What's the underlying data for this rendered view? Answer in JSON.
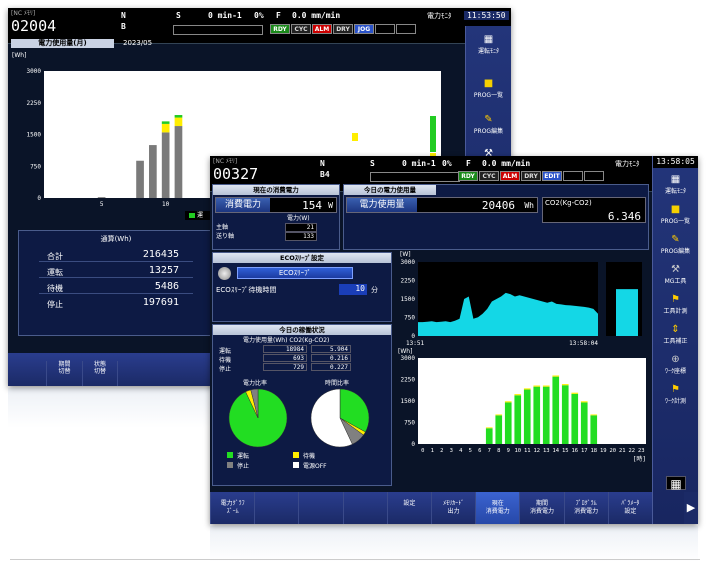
{
  "back": {
    "mode_small": "[NC ﾒﾓﾘ]",
    "prog": "02004",
    "axis1": "N",
    "axis2": "B",
    "spindle_label": "S",
    "spindle_val": "0 min-1",
    "pct": "0%",
    "feed_label": "F",
    "feed_val": "0.0 mm/min",
    "monitor": "電力ﾓﾆﾀ",
    "time": "11:53:50",
    "status": [
      "RDY",
      "CYC",
      "ALM",
      "DRY",
      "JOG"
    ],
    "chart_title": "電力使用量(月)",
    "chart_date": "2023/05",
    "yunit": "[Wh]",
    "legend_partial": "運",
    "table_title": "通算(Wh)",
    "table": [
      {
        "label": "合計",
        "value": "216435"
      },
      {
        "label": "運転",
        "value": "13257"
      },
      {
        "label": "待機",
        "value": "5486"
      },
      {
        "label": "停止",
        "value": "197691"
      }
    ],
    "keys": [
      [
        "期間",
        "切替"
      ],
      [
        "状態",
        "切替"
      ]
    ],
    "side": [
      "運転ﾓﾆﾀ",
      "PROG一覧",
      "PROG編集"
    ]
  },
  "front": {
    "mode_small": "[NC ﾒﾓﾘ]",
    "prog": "00327",
    "axis1": "N",
    "axis2": "B4",
    "spindle_label": "S",
    "spindle_val": "0 min-1",
    "pct": "0%",
    "feed_label": "F",
    "feed_val": "0.0 mm/min",
    "monitor": "電力ﾓﾆﾀ",
    "time": "13:58:05",
    "status": [
      "RDY",
      "CYC",
      "ALM",
      "DRY",
      "EDIT"
    ],
    "cur_title": "現在の消費電力",
    "cur_label": "消費電力",
    "cur_val": "154",
    "cur_unit": "W",
    "today_title": "今日の電力使用量",
    "today_label": "電力使用量",
    "today_val": "20406",
    "today_unit": "Wh",
    "co2_label": "CO2(Kg-CO2)",
    "co2_val": "6.346",
    "pw_head": "電力(W)",
    "pw_rows": [
      {
        "label": "主軸",
        "value": "21"
      },
      {
        "label": "送り軸",
        "value": "133"
      }
    ],
    "eco_title": "ECOｽﾘｰﾌﾟ設定",
    "eco_btn": "ECOｽﾘｰﾌﾟ",
    "eco_wait_label": "ECOｽﾘｰﾌﾟ待機時間",
    "eco_wait_val": "10",
    "eco_wait_unit": "分",
    "stat_title": "今日の稼働状況",
    "stat_head": "電力使用量(Wh) CO2(Kg-CO2)",
    "stat_rows": [
      {
        "label": "運転",
        "wh": "18984",
        "co2": "5.904"
      },
      {
        "label": "待機",
        "wh": "693",
        "co2": "0.216"
      },
      {
        "label": "停止",
        "wh": "729",
        "co2": "0.227"
      }
    ],
    "pie1_title": "電力比率",
    "pie2_title": "時間比率",
    "legend": [
      "運転",
      "待機",
      "停止",
      "電源OFF"
    ],
    "w_unit": "[W]",
    "wh_unit": "[Wh]",
    "w_ticks": [
      "3000",
      "2250",
      "1500",
      "750",
      "0"
    ],
    "wh_ticks": [
      "3000",
      "2250",
      "1500",
      "750",
      "0"
    ],
    "t_start": "13:51",
    "t_end": "13:58:04",
    "hour_unit": "[時]",
    "keys": [
      [
        "電力ｸﾞﾗﾌ",
        "ｽﾞｰﾑ"
      ],
      [
        ""
      ],
      [
        ""
      ],
      [
        ""
      ],
      [
        "設定"
      ],
      [
        "ﾒﾓﾘｶｰﾄﾞ",
        "出力"
      ],
      [
        "現在",
        "消費電力"
      ],
      [
        "期間",
        "消費電力"
      ],
      [
        "ﾌﾟﾛｸﾞﾗﾑ",
        "消費電力"
      ],
      [
        "ﾊﾟﾗﾒｰﾀ",
        "設定"
      ]
    ],
    "side": [
      "運転ﾓﾆﾀ",
      "PROG一覧",
      "PROG編集",
      "MG工具",
      "工具計測",
      "工具補正",
      "ﾜｰｸ座標",
      "ﾜｰｸ計測"
    ]
  },
  "chart_data": [
    {
      "type": "bar",
      "title": "電力使用量(月)",
      "ylabel": "[Wh]",
      "ylim": [
        0,
        3000
      ],
      "yticks": [
        0,
        750,
        1500,
        2250,
        3000
      ],
      "xticks": [
        5,
        10
      ],
      "categories": [
        1,
        2,
        3,
        4,
        5,
        6,
        7,
        8,
        9,
        10,
        11,
        12,
        13,
        14,
        15,
        16,
        17,
        18,
        19,
        20,
        21,
        22,
        23,
        24,
        25,
        26,
        27,
        28,
        29,
        30,
        31
      ],
      "series": [
        {
          "color": "#7a7a7a",
          "values": [
            0,
            0,
            0,
            0,
            20,
            0,
            0,
            880,
            1250,
            1550,
            1700,
            0,
            0,
            0,
            0,
            0,
            0,
            0,
            0,
            0,
            0,
            0,
            0,
            0,
            0,
            0,
            0,
            0,
            0,
            0,
            0
          ]
        },
        {
          "color": "#ffee00",
          "values": [
            0,
            0,
            0,
            0,
            0,
            0,
            0,
            0,
            0,
            200,
            200,
            0,
            0,
            0,
            0,
            0,
            0,
            0,
            0,
            0,
            0,
            0,
            0,
            0,
            0,
            0,
            0,
            0,
            0,
            0,
            0
          ]
        },
        {
          "color": "#22cc22",
          "values": [
            0,
            0,
            0,
            0,
            0,
            0,
            0,
            0,
            0,
            60,
            60,
            0,
            0,
            0,
            0,
            0,
            0,
            0,
            0,
            0,
            0,
            0,
            0,
            0,
            0,
            0,
            0,
            0,
            0,
            0,
            0
          ]
        }
      ]
    },
    {
      "type": "area",
      "title": "",
      "ylabel": "[W]",
      "ylim": [
        0,
        3000
      ],
      "x_range": [
        "13:51",
        "13:58:04"
      ],
      "yticks": [
        0,
        750,
        1500,
        2250,
        3000
      ],
      "values": [
        560,
        560,
        580,
        600,
        560,
        580,
        600,
        560,
        620,
        700,
        1500,
        1600,
        700,
        760,
        900,
        1100,
        1400,
        1500,
        1600,
        1750,
        1700,
        1600,
        1650,
        1600,
        1550,
        1500,
        1450,
        1400,
        1350,
        1400,
        1300,
        1280,
        1250,
        1240,
        1220,
        1200,
        1180,
        1150,
        1100,
        900
      ]
    },
    {
      "type": "bar",
      "title": "",
      "ylabel": "[Wh]",
      "xlabel": "[時]",
      "ylim": [
        0,
        3000
      ],
      "yticks": [
        0,
        750,
        1500,
        2250,
        3000
      ],
      "categories": [
        0,
        1,
        2,
        3,
        4,
        5,
        6,
        7,
        8,
        9,
        10,
        11,
        12,
        13,
        14,
        15,
        16,
        17,
        18,
        19,
        20,
        21,
        22,
        23
      ],
      "series": [
        {
          "name": "運転",
          "color": "#22dd22",
          "values": [
            0,
            0,
            0,
            0,
            0,
            0,
            0,
            550,
            1000,
            1450,
            1700,
            1900,
            2000,
            2000,
            2350,
            2050,
            1750,
            1450,
            1000,
            0,
            0,
            0,
            0,
            0
          ]
        },
        {
          "name": "待機",
          "color": "#ffee00",
          "values": [
            0,
            0,
            0,
            0,
            0,
            0,
            0,
            30,
            30,
            40,
            40,
            40,
            40,
            40,
            40,
            40,
            40,
            40,
            30,
            0,
            0,
            0,
            0,
            0
          ]
        }
      ]
    },
    {
      "type": "pie",
      "title": "電力比率",
      "labels": [
        "運転",
        "待機",
        "停止"
      ],
      "values": [
        93,
        3,
        4
      ],
      "colors": [
        "#22dd22",
        "#ffee00",
        "#808080"
      ]
    },
    {
      "type": "pie",
      "title": "時間比率",
      "labels": [
        "運転",
        "待機",
        "停止",
        "電源OFF"
      ],
      "values": [
        33,
        2,
        8,
        57
      ],
      "colors": [
        "#22dd22",
        "#ffee00",
        "#808080",
        "#ffffff"
      ]
    }
  ]
}
